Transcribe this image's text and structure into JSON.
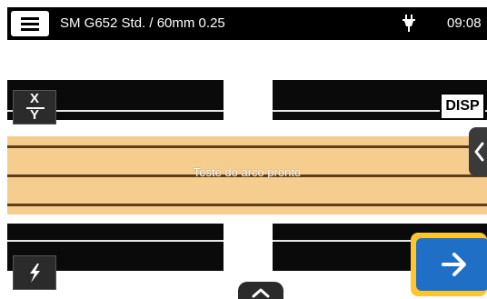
{
  "header": {
    "profile_title": "SM G652 Std. / 60mm 0.25",
    "time": "09:08",
    "power_icon": "plug-icon",
    "menu_icon": "hamburger-menu-icon"
  },
  "viewport": {
    "status_message": "Teste do arco pronto",
    "overlay_color": "#f5cd8e",
    "overlay_line_color": "#5e3d17"
  },
  "controls": {
    "xy_top": "X",
    "xy_bottom": "Y",
    "disp_label": "DISP",
    "flash_icon": "lightning-icon",
    "side_tab_icon": "chevron-left-icon",
    "up_tab_icon": "chevron-up-icon",
    "next_icon": "arrow-right-icon",
    "accent_color": "#1e6fc5",
    "highlight_color": "#ffc52e"
  }
}
